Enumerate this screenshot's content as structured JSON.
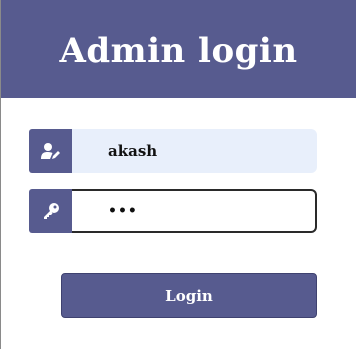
{
  "header": {
    "title": "Admin login"
  },
  "form": {
    "username": {
      "value": "akash",
      "icon": "user-edit-icon"
    },
    "password": {
      "value": "•••",
      "icon": "key-icon"
    },
    "submit_label": "Login"
  },
  "colors": {
    "accent": "#575b8f",
    "input_fill": "#e8effb"
  }
}
